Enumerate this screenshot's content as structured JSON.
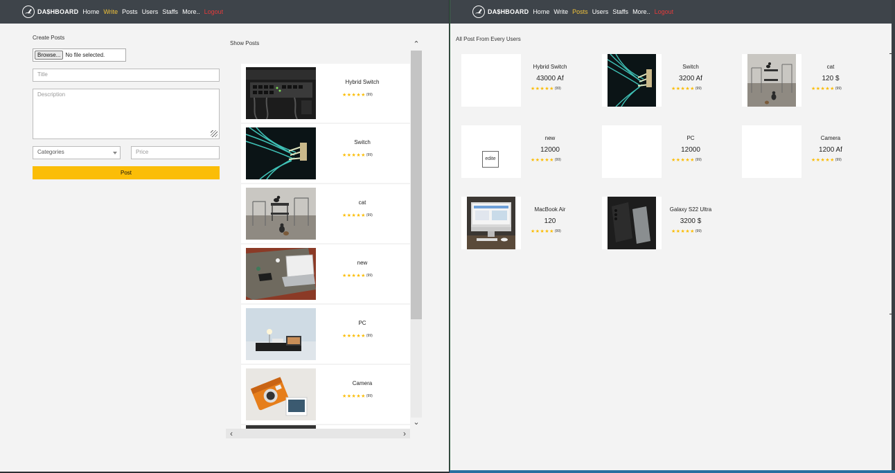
{
  "nav": {
    "brand": "DA$HBOARD",
    "links_left": [
      "Home",
      "Write",
      "Posts",
      "Users",
      "Staffs",
      "More..",
      "Logout"
    ],
    "links_right": [
      "Home",
      "Write",
      "Posts",
      "Users",
      "Staffs",
      "More..",
      "Logout"
    ],
    "active_left": "Write",
    "active_right": "Posts",
    "accent_color": "#f0c23a",
    "logout_color": "#e33b3b"
  },
  "create": {
    "title": "Create Posts",
    "browse_label": "Browse...",
    "file_status": "No file selected.",
    "title_placeholder": "Title",
    "description_placeholder": "Description",
    "category_value": "Categories",
    "price_placeholder": "Price",
    "post_label": "Post",
    "post_color": "#fbbd07"
  },
  "show": {
    "title": "Show Posts",
    "posts": [
      {
        "name": "Hybrid Switch",
        "stars": "★★★★★",
        "count": "(99)",
        "image": "network-switch"
      },
      {
        "name": "Switch",
        "stars": "★★★★★",
        "count": "(99)",
        "image": "fiber-cables"
      },
      {
        "name": "cat",
        "stars": "★★★★★",
        "count": "(99)",
        "image": "cats-room"
      },
      {
        "name": "new",
        "stars": "★★★★★",
        "count": "(99)",
        "image": "laptop-desk"
      },
      {
        "name": "PC",
        "stars": "★★★★★",
        "count": "(99)",
        "image": "pc-desk"
      },
      {
        "name": "Camera",
        "stars": "★★★★★",
        "count": "(99)",
        "image": "instant-camera"
      }
    ]
  },
  "all": {
    "title": "All Post From Every Users",
    "posts": [
      {
        "name": "Hybrid Switch",
        "price": "43000 Af",
        "stars": "★★★★★",
        "count": "(99)",
        "image": "blank"
      },
      {
        "name": "Switch",
        "price": "3200 Af",
        "stars": "★★★★★",
        "count": "(99)",
        "image": "fiber-cables"
      },
      {
        "name": "cat",
        "price": "120 $",
        "stars": "★★★★★",
        "count": "(99)",
        "image": "cats-room"
      },
      {
        "name": "new",
        "price": "12000",
        "stars": "★★★★★",
        "count": "(99)",
        "image": "blank",
        "edit_label": "edite"
      },
      {
        "name": "PC",
        "price": "12000",
        "stars": "★★★★★",
        "count": "(99)",
        "image": "blank"
      },
      {
        "name": "Camera",
        "price": "1200 Af",
        "stars": "★★★★★",
        "count": "(99)",
        "image": "blank"
      },
      {
        "name": "MacBook Air",
        "price": "120",
        "stars": "★★★★★",
        "count": "(99)",
        "image": "imac-desk"
      },
      {
        "name": "Galaxy S22 Ultra",
        "price": "3200 $",
        "stars": "★★★★★",
        "count": "(99)",
        "image": "phone-dark"
      }
    ]
  },
  "icons": {
    "brand": "speedometer-icon",
    "scroll_up": "chevron-up-icon",
    "scroll_down": "chevron-down-icon",
    "scroll_left": "chevron-left-icon",
    "scroll_right": "chevron-right-icon",
    "select": "caret-down-icon"
  }
}
